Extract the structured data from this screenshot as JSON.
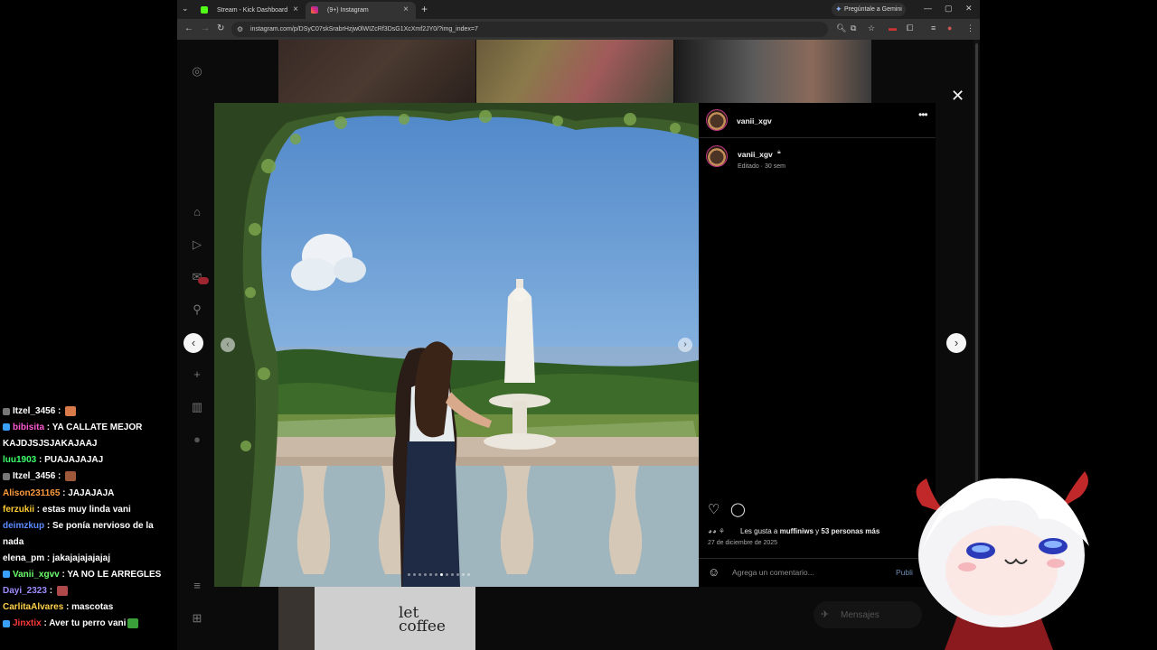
{
  "browser": {
    "tabs": [
      {
        "label": "Stream - Kick Dashboard",
        "favicon_color": "#53fc18",
        "active": false
      },
      {
        "label": "(9+) Instagram",
        "favicon_color": "#e1306c",
        "active": true
      }
    ],
    "gemini_label": "Pregúntale a Gemini",
    "url": "instagram.com/p/DSyC07skSrabrHzjw0lWIZcRf3DsG1XcXmf2JY0/?img_index=7"
  },
  "post": {
    "author": "vanii_xgv",
    "caption_author": "vanii_xgv",
    "edited_time": "Editado · 30 sem",
    "likes_prefix": "Les gusta a ",
    "likes_user": "muffiniws",
    "likes_mid": " y ",
    "likes_count": "53 personas más",
    "date": "27 de diciembre de 2025",
    "comment_placeholder": "Agrega un comentario...",
    "publish_label": "Publi",
    "carousel_total": 12,
    "carousel_index": 7
  },
  "instagram": {
    "messages_label": "Mensajes",
    "notifications_badge": "9+"
  },
  "chat": [
    {
      "user": "Itzel_3456",
      "color": "#ffffff",
      "badge": "#777777",
      "text": " : ",
      "emote": "#d87a4a"
    },
    {
      "user": "bibisita",
      "color": "#ff5ad2",
      "badge": "#3aa0ff",
      "text": " : YA CALLATE MEJOR",
      "emote": ""
    },
    {
      "user": "",
      "color": "#ffffff",
      "badge": "",
      "text": "KAJDJSJSJAKAJAAJ",
      "emote": ""
    },
    {
      "user": "luu1903",
      "color": "#3cff6a",
      "badge": "",
      "text": " : PUAJAJAJAJ",
      "emote": ""
    },
    {
      "user": "Itzel_3456",
      "color": "#ffffff",
      "badge": "#777777",
      "text": " : ",
      "emote": "#a0583a"
    },
    {
      "user": "Alison231165",
      "color": "#ff9b3c",
      "badge": "",
      "text": " : JAJAJAJA",
      "emote": ""
    },
    {
      "user": "ferzukii",
      "color": "#ffcc33",
      "badge": "",
      "text": " : estas muy linda vani",
      "emote": ""
    },
    {
      "user": "deimzkup",
      "color": "#5a8cff",
      "badge": "",
      "text": " : Se ponía nervioso de la",
      "emote": ""
    },
    {
      "user": "",
      "color": "#ffffff",
      "badge": "",
      "text": "nada",
      "emote": ""
    },
    {
      "user": "elena_pm",
      "color": "#ffffff",
      "badge": "",
      "text": " : jakajajajajajaj",
      "emote": ""
    },
    {
      "user": "Vanii_xgvv",
      "color": "#6cff6c",
      "badge": "#3aa0ff",
      "text": " : YA NO LE ARREGLES",
      "emote": ""
    },
    {
      "user": "Dayi_2323",
      "color": "#9f8cff",
      "badge": "",
      "text": " : ",
      "emote": "#b04a4a"
    },
    {
      "user": "CarlitaAlvares",
      "color": "#ffd24a",
      "badge": "",
      "text": " : mascotas",
      "emote": ""
    },
    {
      "user": "Jinxtix",
      "color": "#ff3a3a",
      "badge": "#3aa0ff",
      "text": " : Aver tu perro vani",
      "emote": "#3aa03a"
    }
  ],
  "colors": {
    "ig_bg": "#0b0b0b",
    "panel_bg": "#000000",
    "link_blue": "#6e8db6"
  }
}
